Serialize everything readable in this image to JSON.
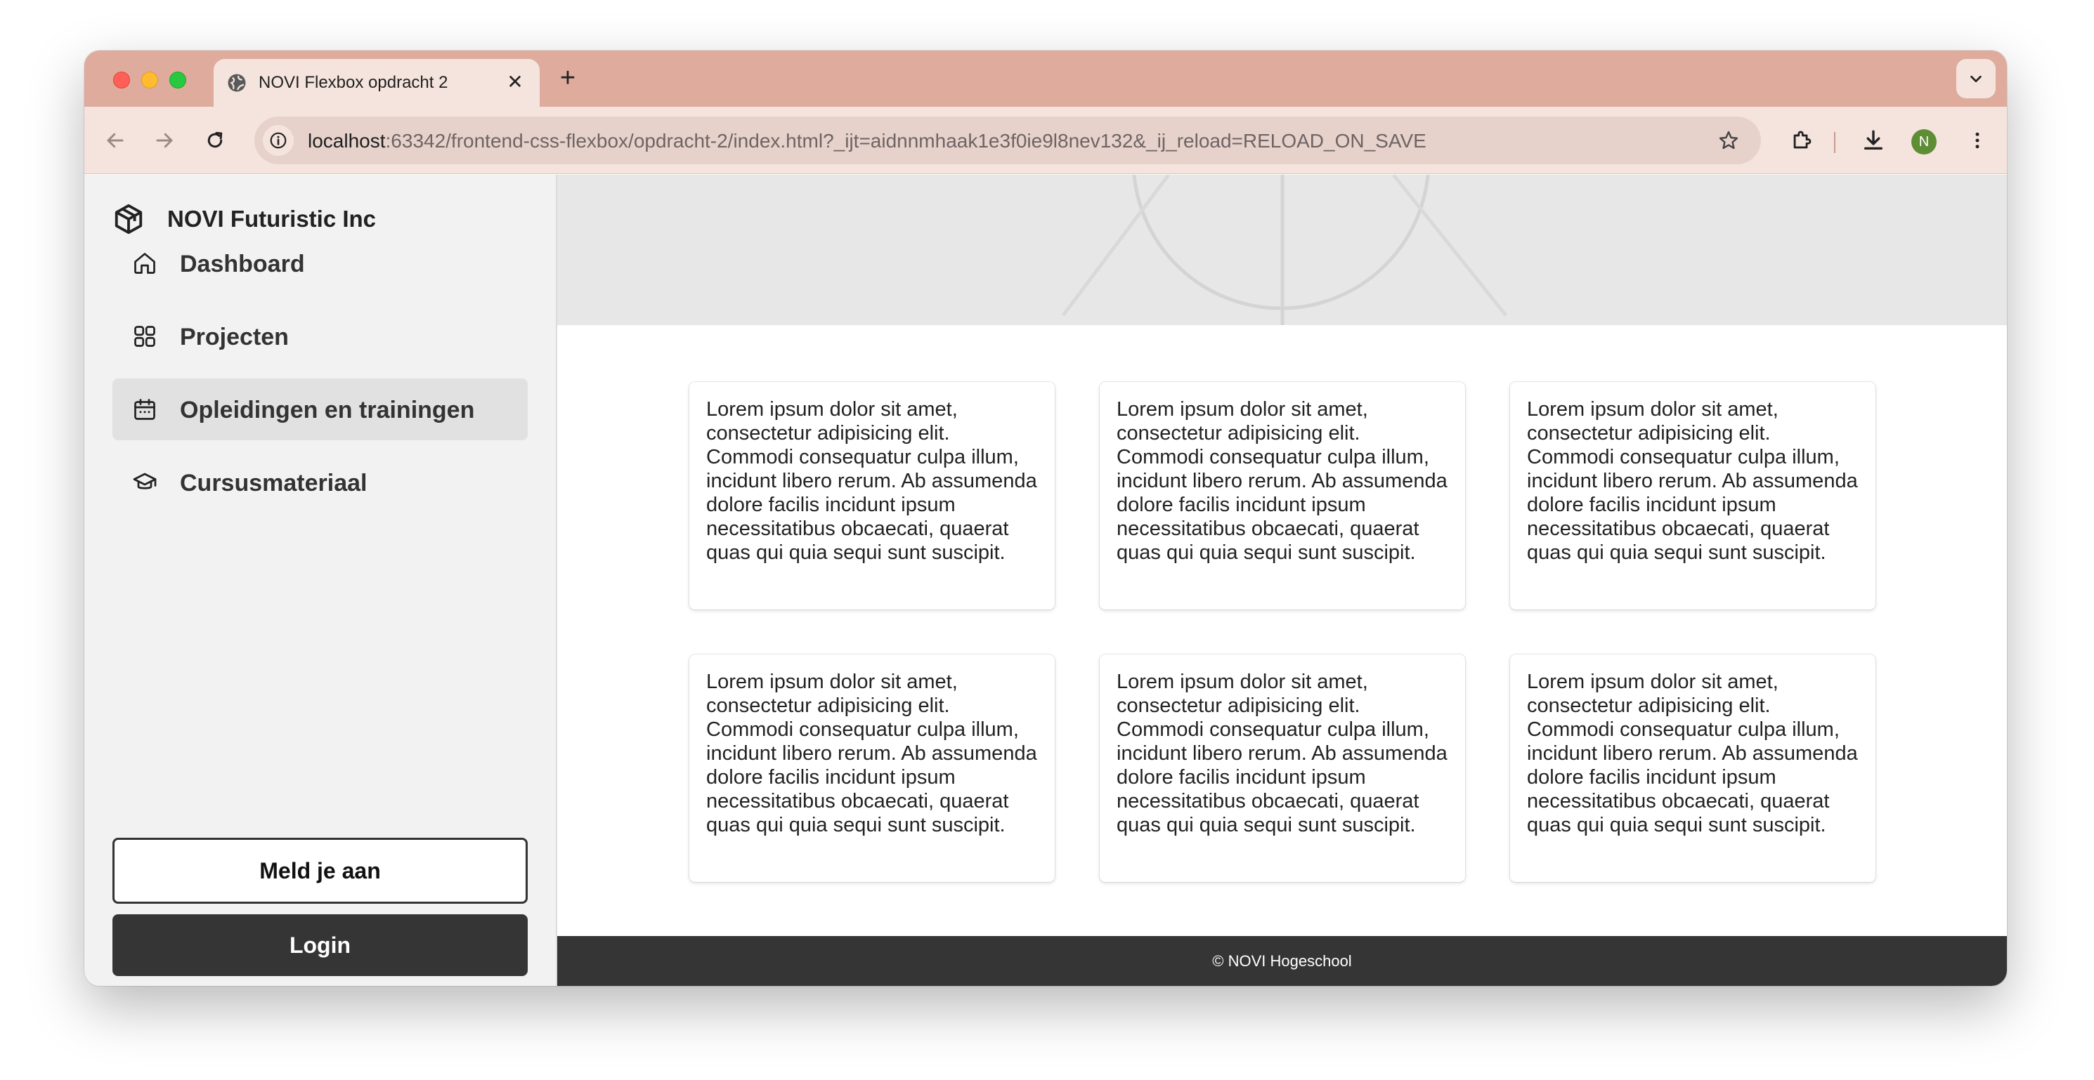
{
  "browser": {
    "tab_title": "NOVI Flexbox opdracht 2",
    "close_glyph": "✕",
    "new_tab_glyph": "+",
    "url_host": "localhost",
    "url_rest": ":63342/frontend-css-flexbox/opdracht-2/index.html?_ijt=aidnnmhaak1e3f0ie9l8nev132&_ij_reload=RELOAD_ON_SAVE",
    "profile_initial": "N",
    "colors": {
      "tabstrip": "#deab9c",
      "toolbar": "#f5e4dd",
      "omnibox": "#e6d2cb",
      "avatar": "#5f8d34"
    }
  },
  "sidebar": {
    "brand": "NOVI Futuristic Inc",
    "items": [
      {
        "label": "Dashboard",
        "icon": "home-icon",
        "active": false
      },
      {
        "label": "Projecten",
        "icon": "grid-icon",
        "active": false
      },
      {
        "label": "Opleidingen en trainingen",
        "icon": "calendar-icon",
        "active": true
      },
      {
        "label": "Cursusmateriaal",
        "icon": "graduation-cap-icon",
        "active": false
      }
    ],
    "signup_label": "Meld je aan",
    "login_label": "Login"
  },
  "main": {
    "cards": [
      {
        "text": "Lorem ipsum dolor sit amet, consectetur adipisicing elit. Commodi consequatur culpa illum, incidunt libero rerum. Ab assumenda dolore facilis incidunt ipsum necessitatibus obcaecati, quaerat quas qui quia sequi sunt suscipit."
      },
      {
        "text": "Lorem ipsum dolor sit amet, consectetur adipisicing elit. Commodi consequatur culpa illum, incidunt libero rerum. Ab assumenda dolore facilis incidunt ipsum necessitatibus obcaecati, quaerat quas qui quia sequi sunt suscipit."
      },
      {
        "text": "Lorem ipsum dolor sit amet, consectetur adipisicing elit. Commodi consequatur culpa illum, incidunt libero rerum. Ab assumenda dolore facilis incidunt ipsum necessitatibus obcaecati, quaerat quas qui quia sequi sunt suscipit."
      },
      {
        "text": "Lorem ipsum dolor sit amet, consectetur adipisicing elit. Commodi consequatur culpa illum, incidunt libero rerum. Ab assumenda dolore facilis incidunt ipsum necessitatibus obcaecati, quaerat quas qui quia sequi sunt suscipit."
      },
      {
        "text": "Lorem ipsum dolor sit amet, consectetur adipisicing elit. Commodi consequatur culpa illum, incidunt libero rerum. Ab assumenda dolore facilis incidunt ipsum necessitatibus obcaecati, quaerat quas qui quia sequi sunt suscipit."
      },
      {
        "text": "Lorem ipsum dolor sit amet, consectetur adipisicing elit. Commodi consequatur culpa illum, incidunt libero rerum. Ab assumenda dolore facilis incidunt ipsum necessitatibus obcaecati, quaerat quas qui quia sequi sunt suscipit."
      }
    ],
    "footer": "© NOVI Hogeschool"
  }
}
